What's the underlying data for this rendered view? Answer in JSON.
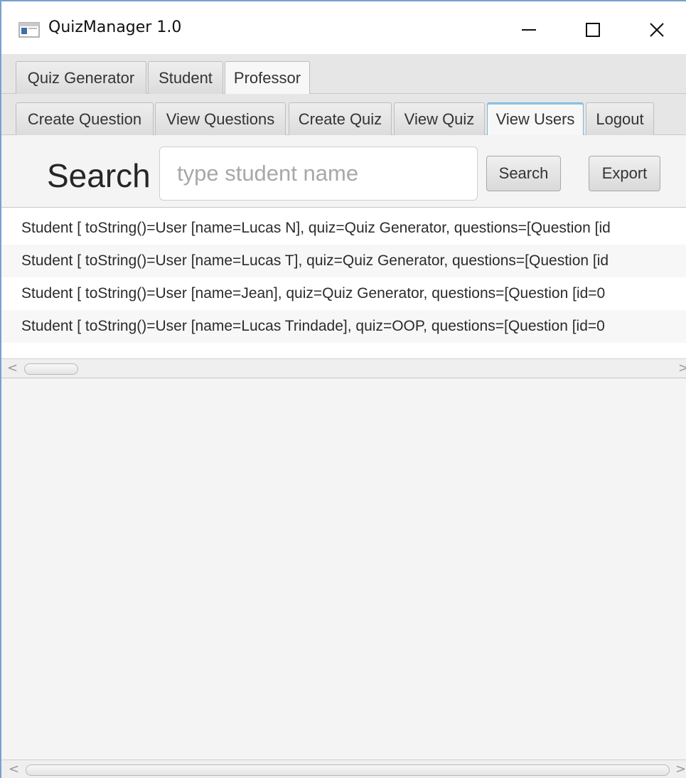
{
  "window": {
    "title": "QuizManager 1.0",
    "controls": {
      "minimize": "—",
      "maximize": "☐",
      "close": "✕"
    }
  },
  "top_tabs": [
    {
      "label": "Quiz Generator",
      "selected": false
    },
    {
      "label": "Student",
      "selected": false
    },
    {
      "label": "Professor",
      "selected": true
    }
  ],
  "sub_tabs": [
    {
      "label": "Create Question",
      "selected": false
    },
    {
      "label": "View Questions",
      "selected": false
    },
    {
      "label": "Create Quiz",
      "selected": false
    },
    {
      "label": "View Quiz",
      "selected": false
    },
    {
      "label": "View Users",
      "selected": true
    },
    {
      "label": "Logout",
      "selected": false
    }
  ],
  "search": {
    "title": "Search",
    "placeholder": "type student name",
    "value": "",
    "search_button": "Search",
    "export_button": "Export"
  },
  "users": [
    "Student [ toString()=User [name=Lucas N], quiz=Quiz Generator, questions=[Question [id",
    "Student [ toString()=User [name=Lucas T], quiz=Quiz Generator, questions=[Question [id",
    "Student [ toString()=User [name=Jean], quiz=Quiz Generator, questions=[Question [id=0",
    "Student [ toString()=User [name=Lucas Trindade], quiz=OOP, questions=[Question [id=0"
  ],
  "scroll": {
    "left_arrow": "<",
    "right_arrow": ">"
  },
  "colors": {
    "window_border": "#7a9fd0",
    "selected_tab_accent": "#8ec4e8"
  },
  "icons": {
    "app": "app-window-icon",
    "minimize": "minimize-icon",
    "maximize": "maximize-icon",
    "close": "close-icon"
  }
}
